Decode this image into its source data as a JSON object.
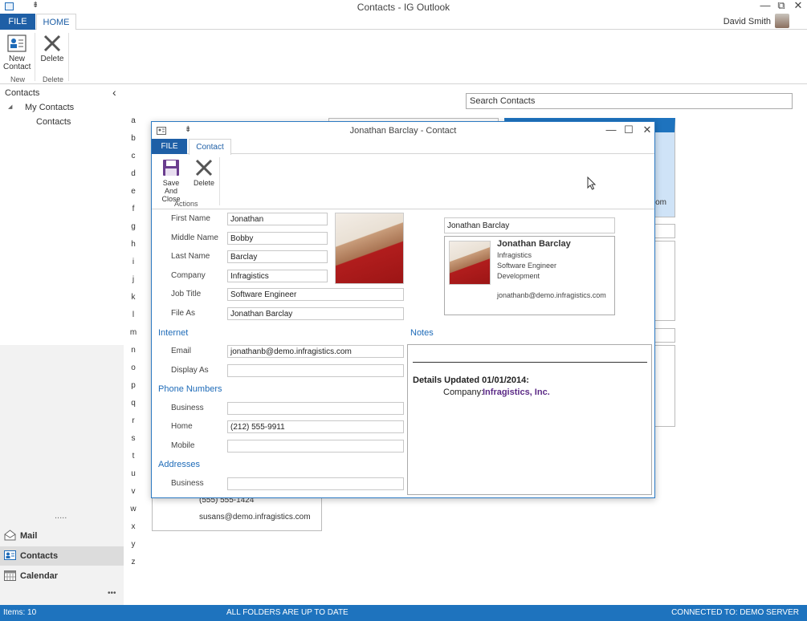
{
  "window": {
    "title": "Contacts - IG Outlook",
    "qat_glyph": "⇟",
    "minimize_glyph": "—",
    "restore_glyph": "⧉",
    "close_glyph": "✕"
  },
  "ribbon": {
    "tabs": {
      "file": "FILE",
      "home": "HOME"
    },
    "user_name": "David Smith",
    "collapse_glyph": "⌃",
    "new_contact_label_1": "New",
    "new_contact_label_2": "Contact",
    "delete_label": "Delete",
    "group_new": "New",
    "group_delete": "Delete"
  },
  "nav": {
    "collapse_glyph": "‹",
    "root": "Contacts",
    "expand_glyph": "◢",
    "my_contacts": "My Contacts",
    "contacts_folder": "Contacts",
    "grip": ".....",
    "buttons": [
      {
        "label": "Mail",
        "icon": "mail-icon"
      },
      {
        "label": "Contacts",
        "icon": "contacts-icon"
      },
      {
        "label": "Calendar",
        "icon": "calendar-icon"
      }
    ],
    "more": "•••"
  },
  "alphabet": [
    "a",
    "b",
    "c",
    "d",
    "e",
    "f",
    "g",
    "h",
    "i",
    "j",
    "k",
    "l",
    "m",
    "n",
    "o",
    "p",
    "q",
    "r",
    "s",
    "t",
    "u",
    "v",
    "w",
    "x",
    "y",
    "z"
  ],
  "search": {
    "placeholder": "Search Contacts"
  },
  "background_card": {
    "phone": "(555) 555-1424",
    "email": "susans@demo.infragistics.com",
    "partial_text": "om"
  },
  "dialog": {
    "title": "Jonathan Barclay - Contact",
    "qat_glyph": "⇟",
    "minimize_glyph": "—",
    "maximize_glyph": "☐",
    "close_glyph": "✕",
    "tabs": {
      "file": "FILE",
      "contact": "Contact"
    },
    "save_close_label_1": "Save And",
    "save_close_label_2": "Close",
    "delete_label": "Delete",
    "group_actions": "Actions",
    "labels": {
      "first_name": "First Name",
      "middle_name": "Middle Name",
      "last_name": "Last Name",
      "company": "Company",
      "job_title": "Job Title",
      "file_as": "File As",
      "email": "Email",
      "display_as": "Display As",
      "business": "Business",
      "home": "Home",
      "mobile": "Mobile",
      "address_business": "Business"
    },
    "values": {
      "first_name": "Jonathan",
      "middle_name": "Bobby",
      "last_name": "Barclay",
      "company": "Infragistics",
      "job_title": "Software Engineer",
      "file_as": "Jonathan Barclay",
      "email": "jonathanb@demo.infragistics.com",
      "display_as": "",
      "business_phone": "",
      "home_phone": "(212) 555-9911",
      "mobile_phone": "",
      "business_address": ""
    },
    "sections": {
      "internet": "Internet",
      "phone_numbers": "Phone Numbers",
      "addresses": "Addresses",
      "notes": "Notes"
    },
    "card_name_field": "Jonathan Barclay",
    "business_card": {
      "name": "Jonathan Barclay",
      "company": "Infragistics",
      "title": "Software Engineer",
      "department": "Development",
      "email": "jonathanb@demo.infragistics.com"
    },
    "notes": {
      "heading": "Details Updated 01/01/2014:",
      "company_label": "Company:",
      "company_value": "Infragistics, Inc."
    }
  },
  "statusbar": {
    "items": "Items: 10",
    "folders": "ALL FOLDERS ARE UP TO DATE",
    "connection": "CONNECTED TO: DEMO SERVER"
  },
  "colors": {
    "accent": "#1e5fa6",
    "statusbar": "#1e73be",
    "section_heading": "#1e6bb8",
    "notes_company": "#5b2a86"
  }
}
